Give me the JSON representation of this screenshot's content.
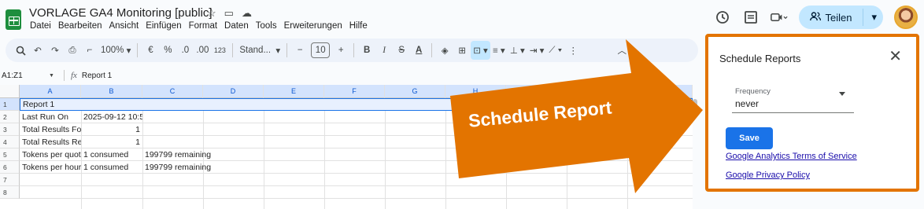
{
  "app": {
    "doc_title": "VORLAGE GA4 Monitoring [public]",
    "menu": [
      "Datei",
      "Bearbeiten",
      "Ansicht",
      "Einfügen",
      "Format",
      "Daten",
      "Tools",
      "Erweiterungen",
      "Hilfe"
    ],
    "share_label": "Teilen",
    "accent_color": "#1e8e3e",
    "share_color": "#c2e7ff"
  },
  "toolbar": {
    "zoom": "100%",
    "currency": "€",
    "percent": "%",
    "dec_decrease": ".0",
    "dec_increase": ".00",
    "number_format": "123",
    "font_name": "Stand...",
    "font_size_minus": "−",
    "font_size": "10",
    "font_size_plus": "+",
    "bold": "B",
    "italic": "I",
    "strike": "S",
    "text_color": "A"
  },
  "formula_bar": {
    "name_box": "A1:Z1",
    "formula": "Report 1"
  },
  "grid": {
    "columns": [
      "A",
      "B",
      "C",
      "D",
      "E",
      "F",
      "G",
      "H"
    ],
    "row_numbers": [
      "1",
      "2",
      "3",
      "4",
      "5",
      "6",
      "7",
      "8"
    ],
    "rows": [
      {
        "a": "Report 1",
        "b": "",
        "c": ""
      },
      {
        "a": "Last Run On",
        "b": "2025-09-12 10:5",
        "c": ""
      },
      {
        "a": "Total Results Fo",
        "b": "1",
        "c": ""
      },
      {
        "a": "Total Results Re",
        "b": "1",
        "c": ""
      },
      {
        "a": "Tokens per quot",
        "b": "1 consumed",
        "c": "199799 remaining"
      },
      {
        "a": "Tokens per hour",
        "b": "1 consumed",
        "c": "199799 remaining"
      },
      {
        "a": "",
        "b": "",
        "c": ""
      },
      {
        "a": "",
        "b": "",
        "c": ""
      }
    ]
  },
  "callout": {
    "text": "Schedule Report",
    "color": "#e37400"
  },
  "panel": {
    "title": "Schedule Reports",
    "frequency_label": "Frequency",
    "frequency_value": "never",
    "save_label": "Save",
    "links": [
      "Google Analytics Terms of Service",
      "Google Privacy Policy"
    ],
    "border_color": "#e37400",
    "button_color": "#1a73e8"
  }
}
